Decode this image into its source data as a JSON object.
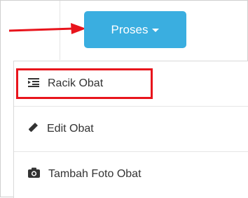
{
  "toolbar": {
    "proses_label": "Proses",
    "button_color": "#3aaee0",
    "caret_icon": "caret-down-icon"
  },
  "annotation": {
    "arrow_color": "#e8141c",
    "highlight_color": "#e8141c"
  },
  "menu": {
    "items": [
      {
        "label": "Racik Obat",
        "icon": "indent-list-icon"
      },
      {
        "label": "Edit Obat",
        "icon": "pencil-icon"
      },
      {
        "label": "Tambah Foto Obat",
        "icon": "camera-icon"
      }
    ]
  }
}
